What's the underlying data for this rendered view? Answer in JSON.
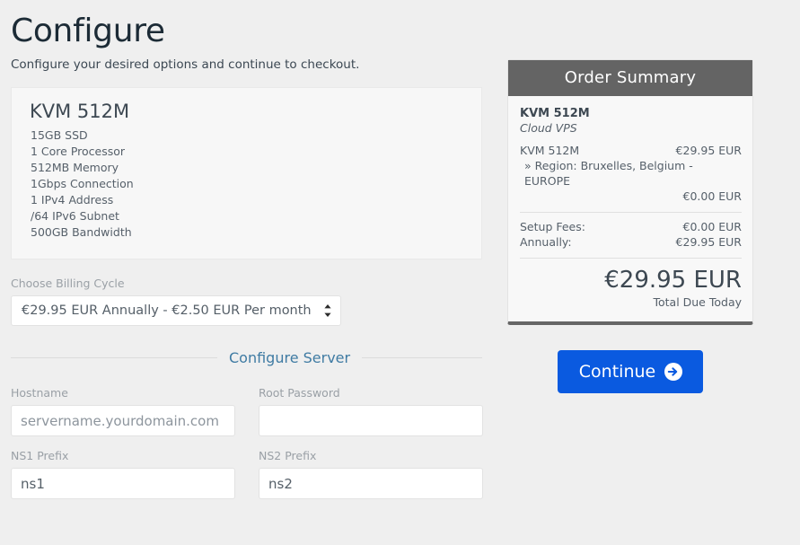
{
  "header": {
    "title": "Configure",
    "subtitle": "Configure your desired options and continue to checkout."
  },
  "product": {
    "name": "KVM 512M",
    "features": [
      "15GB SSD",
      "1 Core Processor",
      "512MB Memory",
      "1Gbps Connection",
      "1 IPv4 Address",
      "/64 IPv6 Subnet",
      "500GB Bandwidth"
    ]
  },
  "billing": {
    "label": "Choose Billing Cycle",
    "selected": "€29.95 EUR Annually - €2.50 EUR Per month",
    "options": [
      "€29.95 EUR Annually - €2.50 EUR Per month"
    ]
  },
  "configure_server": {
    "section_title": "Configure Server",
    "fields": {
      "hostname": {
        "label": "Hostname",
        "value": "",
        "placeholder": "servername.yourdomain.com"
      },
      "root_password": {
        "label": "Root Password",
        "value": "",
        "placeholder": ""
      },
      "ns1_prefix": {
        "label": "NS1 Prefix",
        "value": "ns1",
        "placeholder": "ns1"
      },
      "ns2_prefix": {
        "label": "NS2 Prefix",
        "value": "ns2",
        "placeholder": "ns2"
      }
    }
  },
  "order_summary": {
    "header": "Order Summary",
    "product_name": "KVM 512M",
    "product_group": "Cloud VPS",
    "line_item": {
      "label": "KVM 512M",
      "price": "€29.95 EUR"
    },
    "config_option": {
      "label": "» Region: Bruxelles, Belgium - EUROPE",
      "price": "€0.00 EUR"
    },
    "totals": [
      {
        "label": "Setup Fees:",
        "value": "€0.00 EUR"
      },
      {
        "label": "Annually:",
        "value": "€29.95 EUR"
      }
    ],
    "total_due_amount": "€29.95 EUR",
    "total_due_label": "Total Due Today"
  },
  "actions": {
    "continue_label": "Continue",
    "continue_icon": "arrow-circle-right-icon"
  },
  "colors": {
    "page_background": "#efefef",
    "summary_header_bg": "#646464",
    "continue_button_bg": "#0a5ae0",
    "section_title": "#3f7ba3",
    "product_box_bg": "#f7f7f7"
  }
}
